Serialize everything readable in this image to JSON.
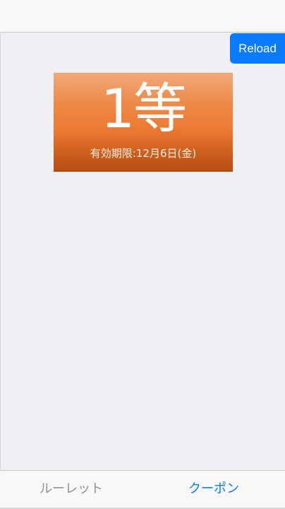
{
  "header": {
    "reload_label": "Reload"
  },
  "coupon": {
    "rank": "1等",
    "expiry": "有効期限:12月6日(金)",
    "colors": {
      "gradient_top": "#f1a87a",
      "gradient_mid": "#ec7c35",
      "gradient_bottom": "#b24d12"
    }
  },
  "tabs": [
    {
      "label": "ルーレット",
      "active": false
    },
    {
      "label": "クーポン",
      "active": true
    }
  ],
  "colors": {
    "accent": "#0a7aff",
    "background": "#f0eff4",
    "inactive_tab": "#929292"
  }
}
